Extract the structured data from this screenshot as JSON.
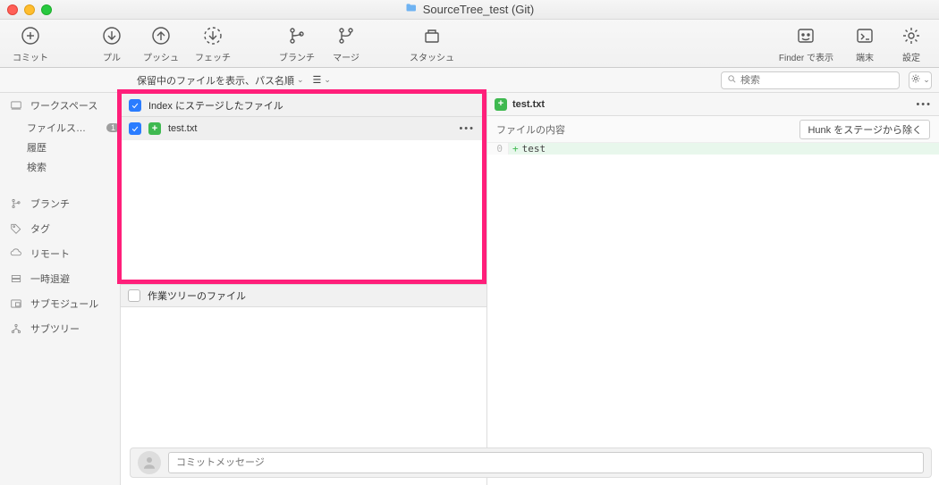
{
  "window": {
    "title": "SourceTree_test (Git)"
  },
  "toolbar": {
    "commit": "コミット",
    "pull": "プル",
    "push": "プッシュ",
    "fetch": "フェッチ",
    "branch": "ブランチ",
    "merge": "マージ",
    "stash": "スタッシュ",
    "showFinder": "Finder で表示",
    "terminal": "端末",
    "settings": "設定"
  },
  "filter": {
    "pending": "保留中のファイルを表示、パス名順",
    "searchPlaceholder": "検索"
  },
  "sidebar": {
    "workspace": "ワークスペース",
    "fileStatus": "ファイルス…",
    "fileStatusBadge": "1",
    "history": "履歴",
    "search": "検索",
    "branches": "ブランチ",
    "tags": "タグ",
    "remotes": "リモート",
    "stashes": "一時退避",
    "submodules": "サブモジュール",
    "subtrees": "サブツリー"
  },
  "staged": {
    "header": "Index にステージしたファイル",
    "file": "test.txt",
    "worktreeHeader": "作業ツリーのファイル"
  },
  "diff": {
    "filename": "test.txt",
    "contentLabel": "ファイルの内容",
    "hunkButton": "Hunk をステージから除く",
    "lineNum": "0",
    "lineSign": "+",
    "lineCode": "test"
  },
  "commit": {
    "placeholder": "コミットメッセージ"
  }
}
